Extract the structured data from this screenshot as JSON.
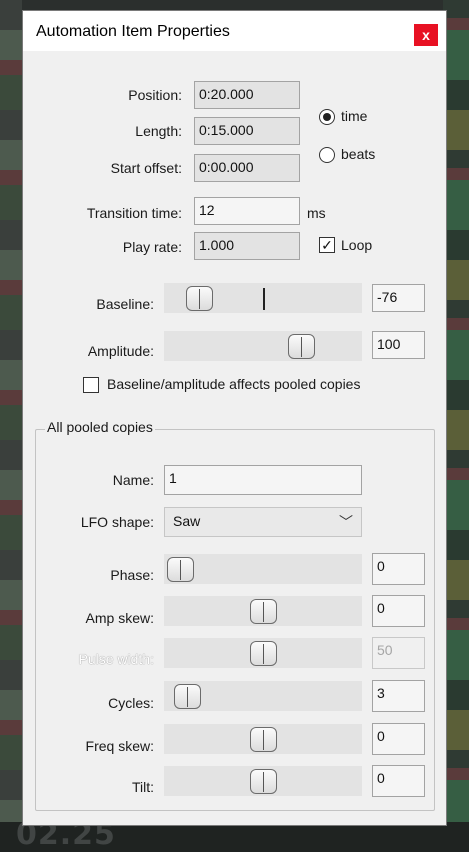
{
  "window": {
    "title": "Automation Item Properties",
    "close_label": "x"
  },
  "timing": {
    "position_label": "Position:",
    "position_value": "0:20.000",
    "length_label": "Length:",
    "length_value": "0:15.000",
    "start_offset_label": "Start offset:",
    "start_offset_value": "0:00.000",
    "transition_label": "Transition time:",
    "transition_value": "12",
    "transition_unit": "ms",
    "play_rate_label": "Play rate:",
    "play_rate_value": "1.000"
  },
  "mode": {
    "time_label": "time",
    "beats_label": "beats",
    "selected": "time"
  },
  "loop": {
    "label": "Loop",
    "checked": true
  },
  "baseline": {
    "label": "Baseline:",
    "value": "-76"
  },
  "amplitude": {
    "label": "Amplitude:",
    "value": "100"
  },
  "pooled_checkbox": {
    "label": "Baseline/amplitude affects pooled copies",
    "checked": false
  },
  "pooled": {
    "group_label": "All pooled copies",
    "name_label": "Name:",
    "name_value": "1",
    "lfo_label": "LFO shape:",
    "lfo_value": "Saw",
    "phase_label": "Phase:",
    "phase_value": "0",
    "amp_skew_label": "Amp skew:",
    "amp_skew_value": "0",
    "pulse_width_label": "Pulse width:",
    "pulse_width_value": "50",
    "cycles_label": "Cycles:",
    "cycles_value": "3",
    "freq_skew_label": "Freq skew:",
    "freq_skew_value": "0",
    "tilt_label": "Tilt:",
    "tilt_value": "0"
  },
  "background": {
    "bottom_text": "02.25"
  }
}
